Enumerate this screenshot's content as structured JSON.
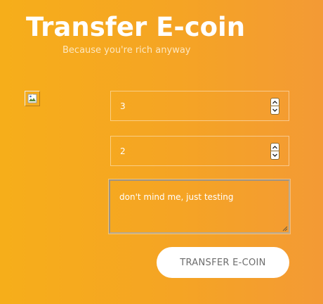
{
  "header": {
    "title": "Transfer E-coin",
    "subtitle": "Because you're rich anyway"
  },
  "broken_image": {
    "icon": "broken-image-icon"
  },
  "form": {
    "field_1": {
      "value": "3"
    },
    "field_2": {
      "value": "2"
    },
    "message": {
      "value": "don't mind me, just testing"
    },
    "submit_label": "TRANSFER E-COIN"
  },
  "colors": {
    "gradient_start": "#f6ae1a",
    "gradient_end": "#f39a35",
    "button_bg": "#ffffff",
    "button_text": "#6d6d6d",
    "text": "#ffffff"
  }
}
